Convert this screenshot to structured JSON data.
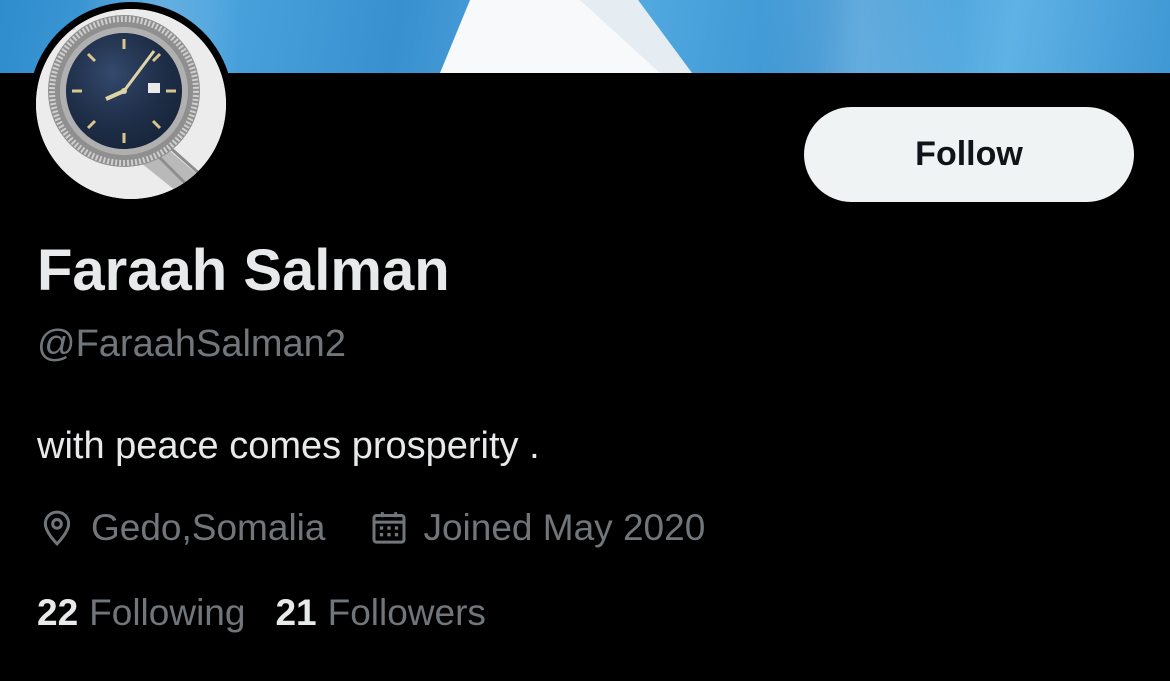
{
  "profile": {
    "display_name": "Faraah Salman",
    "handle": "@FaraahSalman2",
    "bio": "with peace comes prosperity .",
    "location": "Gedo,Somalia",
    "joined": "Joined May 2020"
  },
  "actions": {
    "follow_label": "Follow"
  },
  "stats": {
    "following_count": "22",
    "following_label": "Following",
    "followers_count": "21",
    "followers_label": "Followers"
  },
  "icons": {
    "location": "location-pin-icon",
    "calendar": "calendar-icon"
  },
  "colors": {
    "background": "#000000",
    "banner_blue": "#4189dd",
    "primary_text": "#e7e9ea",
    "secondary_text": "#71767b",
    "follow_button_bg": "#eff3f4",
    "follow_button_text": "#0f1419"
  }
}
